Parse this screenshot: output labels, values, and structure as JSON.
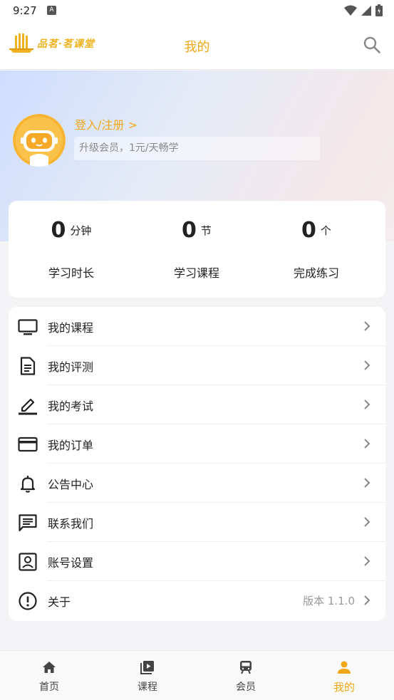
{
  "status_bar": {
    "time": "9:27",
    "notification_letter": "A"
  },
  "header": {
    "logo_text": "品茗·茗课堂",
    "title": "我的",
    "search_icon": "search-icon"
  },
  "profile": {
    "login_text": "登入/注册 >",
    "vip_text": "升级会员，1元/天畅学"
  },
  "stats": [
    {
      "value": "0",
      "unit": "分钟",
      "label": "学习时长"
    },
    {
      "value": "0",
      "unit": "节",
      "label": "学习课程"
    },
    {
      "value": "0",
      "unit": "个",
      "label": "完成练习"
    }
  ],
  "menu": [
    {
      "label": "我的课程",
      "icon": "tv-icon"
    },
    {
      "label": "我的评测",
      "icon": "document-icon"
    },
    {
      "label": "我的考试",
      "icon": "pen-icon"
    },
    {
      "label": "我的订单",
      "icon": "credit-card-icon"
    },
    {
      "label": "公告中心",
      "icon": "bell-icon"
    },
    {
      "label": "联系我们",
      "icon": "chat-icon"
    },
    {
      "label": "账号设置",
      "icon": "account-box-icon"
    },
    {
      "label": "关于",
      "icon": "info-icon",
      "extra": "版本 1.1.0"
    }
  ],
  "tabs": [
    {
      "label": "首页",
      "icon": "home-icon"
    },
    {
      "label": "课程",
      "icon": "video-library-icon"
    },
    {
      "label": "会员",
      "icon": "vip-train-icon"
    },
    {
      "label": "我的",
      "icon": "person-icon",
      "active": true
    }
  ],
  "colors": {
    "accent": "#f0a818",
    "text": "#222222",
    "muted": "#999999"
  }
}
